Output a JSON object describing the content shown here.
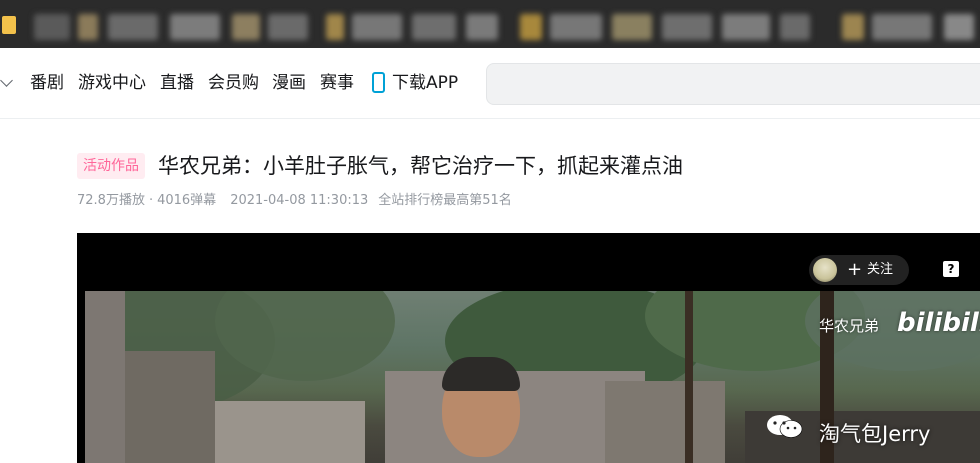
{
  "nav": {
    "items": [
      "番剧",
      "游戏中心",
      "直播",
      "会员购",
      "漫画",
      "赛事"
    ],
    "download_label": "下载APP"
  },
  "video": {
    "badge": "活动作品",
    "title": "华农兄弟：小羊肚子胀气，帮它治疗一下，抓起来灌点油",
    "plays": "72.8万播放",
    "separator": "·",
    "danmaku": "4016弹幕",
    "date": "2021-04-08 11:30:13",
    "rank": "全站排行榜最高第51名"
  },
  "player": {
    "follow_label": "关注",
    "follow_plus": "+",
    "help_glyph": "?",
    "watermark_text": "华农兄弟",
    "watermark_logo": "bilibili",
    "overlay_text": "淘气包Jerry"
  },
  "colors": {
    "accent_pink": "#ff6699",
    "badge_bg": "#ffecf1",
    "app_blue": "#00a1d6",
    "meta_gray": "#9499a0"
  },
  "icons": [
    "chevron-down-icon",
    "phone-icon",
    "help-icon",
    "wechat-icon"
  ]
}
